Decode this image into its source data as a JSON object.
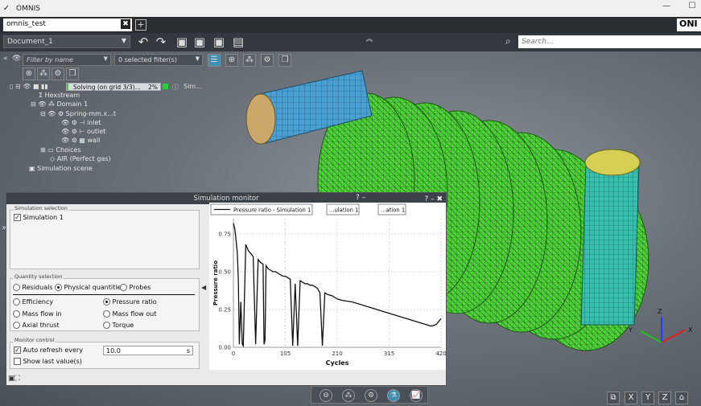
{
  "window": {
    "title": "OMNIS",
    "minimize": "—",
    "maximize": "☐"
  },
  "project": {
    "tab": "omnis_test",
    "close": "✖",
    "add": "+",
    "brand": "ONI"
  },
  "toolbar": {
    "document": "Document_1",
    "search_placeholder": "Search..."
  },
  "filter": {
    "placeholder": "Filter by name",
    "selected": "0 selected filter(s)"
  },
  "tree": {
    "solving": "Solving (on grid 3/3)...",
    "percent": "2%",
    "progress": 0.02,
    "sim_label": "Sim...",
    "items": [
      "Hexstream",
      "Domain 1",
      "Spring-mm.x...t",
      "inlet",
      "outlet",
      "wall",
      "Choices",
      "AIR (Perfect gas)",
      "Simulation scene"
    ]
  },
  "monitor": {
    "title": "Simulation monitor",
    "sim_selection_label": "Simulation selection",
    "simulation": "Simulation 1",
    "quantity_label": "Quantity selection",
    "tabs": [
      "Residuals",
      "Physical quantities",
      "Probes"
    ],
    "quantities": [
      "Efficiency",
      "Pressure ratio",
      "Mass flow in",
      "Mass flow out",
      "Axial thrust",
      "Torque"
    ],
    "control_label": "Monitor control",
    "auto_refresh": "Auto refresh every",
    "refresh_value": "10.0",
    "refresh_unit": "s",
    "show_last": "Show last value(s)"
  },
  "chart_data": {
    "type": "line",
    "title": "",
    "legend": [
      "Pressure ratio - Simulation 1",
      "...ulation 1",
      "...ation 1"
    ],
    "xlabel": "Cycles",
    "ylabel": "Pressure ratio",
    "xlim": [
      0,
      420
    ],
    "ylim": [
      0,
      0.85
    ],
    "xticks": [
      "0",
      "105",
      "210",
      "315",
      "420"
    ],
    "yticks": [
      "0.00",
      "0.25",
      "0.50",
      "0.75"
    ],
    "grid": true,
    "series": [
      {
        "name": "Pressure ratio - Simulation 1",
        "x": [
          0,
          3,
          5,
          8,
          10,
          12,
          15,
          18,
          20,
          25,
          30,
          35,
          40,
          45,
          50,
          55,
          60,
          62,
          64,
          66,
          70,
          75,
          80,
          85,
          90,
          95,
          100,
          105,
          110,
          115,
          120,
          125,
          130,
          135,
          140,
          145,
          150,
          155,
          160,
          165,
          170,
          175,
          180,
          185,
          190,
          200,
          210,
          220,
          240,
          260,
          280,
          300,
          320,
          340,
          360,
          380,
          400,
          410,
          420
        ],
        "y": [
          0.82,
          0.78,
          0.72,
          0.62,
          0.45,
          0.02,
          0.3,
          0.02,
          0.01,
          0.68,
          0.64,
          0.62,
          0.6,
          0.02,
          0.58,
          0.56,
          0.55,
          0.02,
          0.05,
          0.54,
          0.52,
          0.51,
          0.5,
          0.5,
          0.49,
          0.48,
          0.47,
          0.47,
          0.46,
          0.45,
          0.01,
          0.42,
          0.01,
          0.44,
          0.43,
          0.42,
          0.42,
          0.41,
          0.41,
          0.4,
          0.39,
          0.36,
          0.01,
          0.36,
          0.35,
          0.34,
          0.32,
          0.31,
          0.3,
          0.28,
          0.26,
          0.24,
          0.22,
          0.2,
          0.18,
          0.16,
          0.14,
          0.15,
          0.19
        ]
      }
    ]
  },
  "axes": {
    "x": "X",
    "y": "Y",
    "z": "Z"
  }
}
